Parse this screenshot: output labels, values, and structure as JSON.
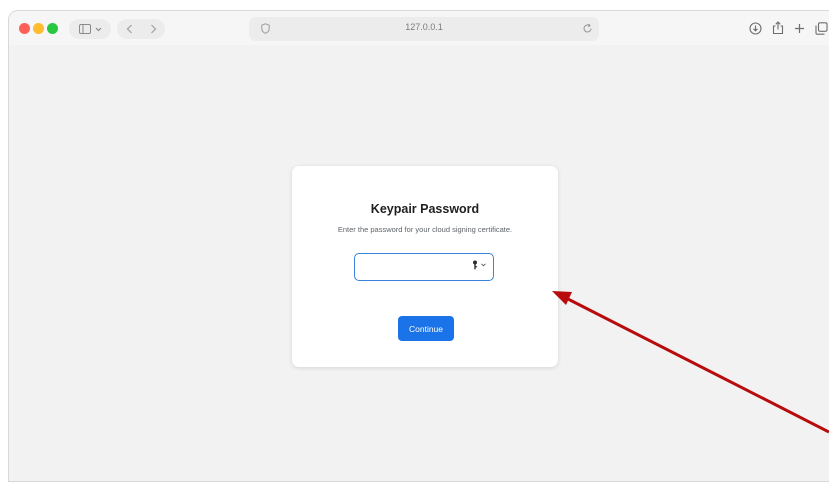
{
  "browser": {
    "url": "127.0.0.1",
    "icons": {
      "close": "traffic-close",
      "minimize": "traffic-minimize",
      "maximize": "traffic-maximize",
      "sidebar": "sidebar-icon",
      "back": "chevron-left-icon",
      "forward": "chevron-right-icon",
      "shield": "shield-icon",
      "reload": "reload-icon",
      "download": "download-icon",
      "share": "share-icon",
      "new_tab": "plus-icon",
      "tab_overview": "tabs-icon"
    }
  },
  "dialog": {
    "title": "Keypair Password",
    "description": "Enter the password for your cloud signing certificate.",
    "password_value": "",
    "password_placeholder": "",
    "continue_label": "Continue",
    "key_icon": "key-icon"
  },
  "colors": {
    "accent": "#1a73e8",
    "input_focus_border": "#3b82d8",
    "annotation_arrow": "#b80c0c",
    "page_background": "#f2f2f2"
  }
}
